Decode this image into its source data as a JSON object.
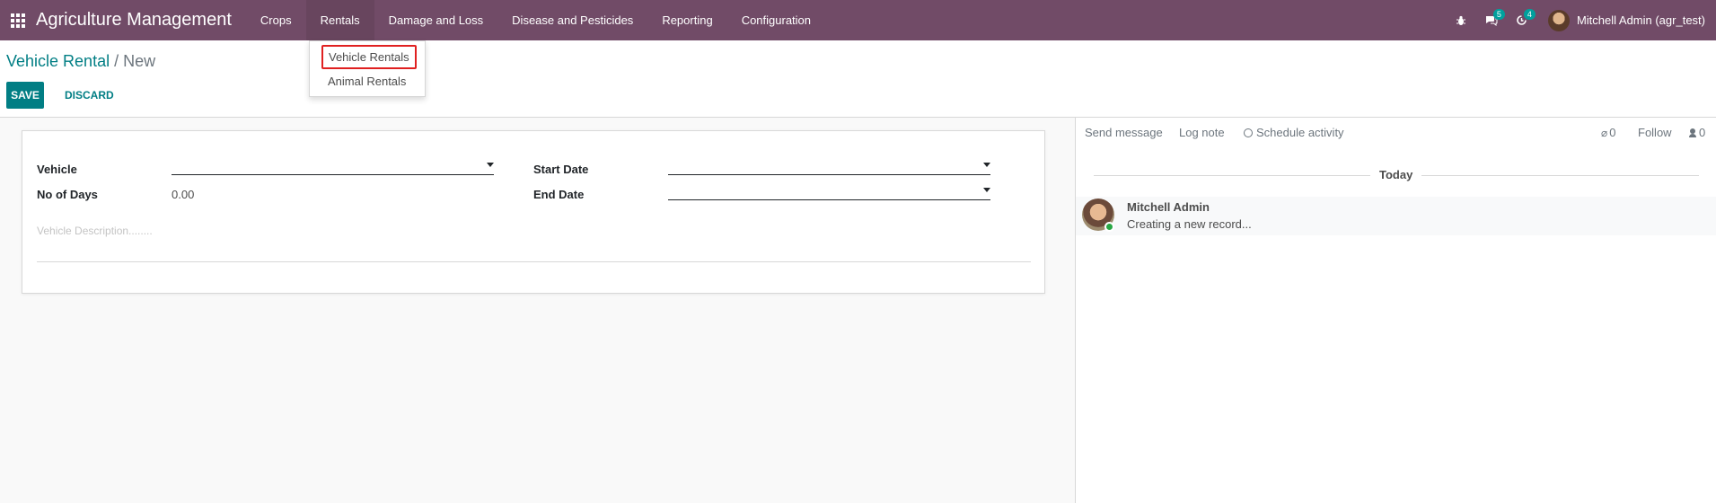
{
  "navbar": {
    "brand": "Agriculture Management",
    "menu": [
      "Crops",
      "Rentals",
      "Damage and Loss",
      "Disease and Pesticides",
      "Reporting",
      "Configuration"
    ],
    "messages_badge": "5",
    "activities_badge": "4",
    "user_name": "Mitchell Admin (agr_test)",
    "bg_color": "#714b67"
  },
  "dropdown": {
    "items": [
      "Vehicle Rentals",
      "Animal Rentals"
    ]
  },
  "breadcrumb": {
    "parent": "Vehicle Rental",
    "separator": "/",
    "current": "New"
  },
  "buttons": {
    "save": "SAVE",
    "discard": "DISCARD"
  },
  "form": {
    "vehicle_label": "Vehicle",
    "days_label": "No of Days",
    "days_value": "0.00",
    "start_label": "Start Date",
    "end_label": "End Date",
    "description_placeholder": "Vehicle Description........"
  },
  "chatter": {
    "send_message": "Send message",
    "log_note": "Log note",
    "schedule_activity": "Schedule activity",
    "attachments_count": "0",
    "follow": "Follow",
    "followers_count": "0",
    "date_separator": "Today",
    "message_author": "Mitchell Admin",
    "message_body": "Creating a new record..."
  }
}
